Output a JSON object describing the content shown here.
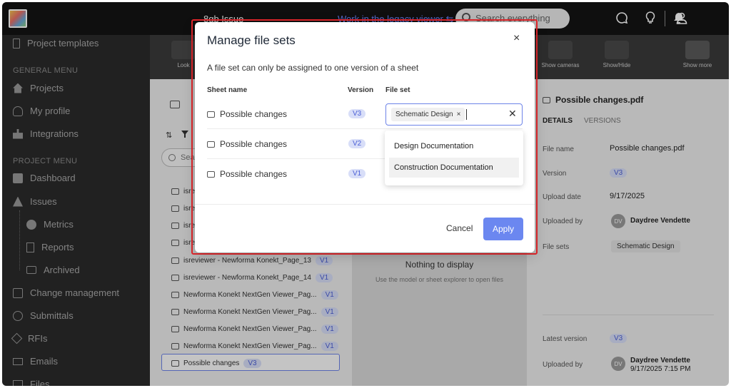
{
  "topbar": {
    "title": "8gb Issue",
    "legacy_link": "Work in the legacy viewer ⇆",
    "search_placeholder": "Search everything"
  },
  "sidebar": {
    "project_templates": "Project templates",
    "general_menu": "GENERAL MENU",
    "projects": "Projects",
    "my_profile": "My profile",
    "integrations": "Integrations",
    "project_menu": "PROJECT MENU",
    "dashboard": "Dashboard",
    "issues": "Issues",
    "metrics": "Metrics",
    "reports": "Reports",
    "archived": "Archived",
    "change_management": "Change management",
    "submittals": "Submittals",
    "rfis": "RFIs",
    "emails": "Emails",
    "files": "Files"
  },
  "toolbar": {
    "look": "Look",
    "show_cameras": "Show cameras",
    "show_hide": "Show/Hide",
    "show_more": "Show more"
  },
  "list": {
    "search_placeholder": "Sea",
    "rows": [
      {
        "name": "isre",
        "badge": ""
      },
      {
        "name": "isre",
        "badge": ""
      },
      {
        "name": "isre",
        "badge": ""
      },
      {
        "name": "isre",
        "badge": ""
      },
      {
        "name": "isreviewer - Newforma Konekt_Page_13",
        "badge": "V1"
      },
      {
        "name": "isreviewer - Newforma Konekt_Page_14",
        "badge": "V1"
      },
      {
        "name": "Newforma Konekt NextGen Viewer_Pag...",
        "badge": "V1"
      },
      {
        "name": "Newforma Konekt NextGen Viewer_Pag...",
        "badge": "V1"
      },
      {
        "name": "Newforma Konekt NextGen Viewer_Pag...",
        "badge": "V1"
      },
      {
        "name": "Newforma Konekt NextGen Viewer_Pag...",
        "badge": "V1"
      },
      {
        "name": "Possible changes",
        "badge": "V3"
      }
    ]
  },
  "viewer": {
    "nothing": "Nothing to display",
    "hint": "Use the model or sheet explorer to open files"
  },
  "details": {
    "file_title": "Possible changes.pdf",
    "tab_details": "DETAILS",
    "tab_versions": "VERSIONS",
    "file_name_label": "File name",
    "file_name_value": "Possible changes.pdf",
    "version_label": "Version",
    "version_value": "V3",
    "upload_date_label": "Upload date",
    "upload_date_value": "9/17/2025",
    "uploaded_by_label": "Uploaded by",
    "uploaded_by_initials": "DV",
    "uploaded_by_value": "Daydree Vendette",
    "file_sets_label": "File sets",
    "file_sets_value": "Schematic Design",
    "latest_version_label": "Latest version",
    "latest_version_value": "V3",
    "uploaded_by2_label": "Uploaded by",
    "uploaded_by2_initials": "DV",
    "uploaded_by2_name": "Daydree Vendette",
    "uploaded_by2_time": "9/17/2025 7:15 PM"
  },
  "modal": {
    "title": "Manage file sets",
    "close": "×",
    "description": "A file set can only be assigned to one version of a sheet",
    "col_sheet": "Sheet name",
    "col_version": "Version",
    "col_fileset": "File set",
    "rows": [
      {
        "sheet": "Possible changes",
        "version": "V3"
      },
      {
        "sheet": "Possible changes",
        "version": "V2"
      },
      {
        "sheet": "Possible changes",
        "version": "V1"
      }
    ],
    "selected_tag": "Schematic Design",
    "tag_remove": "×",
    "clear": "✕",
    "options": [
      "Design Documentation",
      "Construction Documentation"
    ],
    "cancel": "Cancel",
    "apply": "Apply"
  },
  "colors": {
    "accent": "#6b87f0",
    "highlight_outline": "#e3262b",
    "sidebar_bg": "#2b2b2b",
    "topbar_bg": "#141414"
  }
}
